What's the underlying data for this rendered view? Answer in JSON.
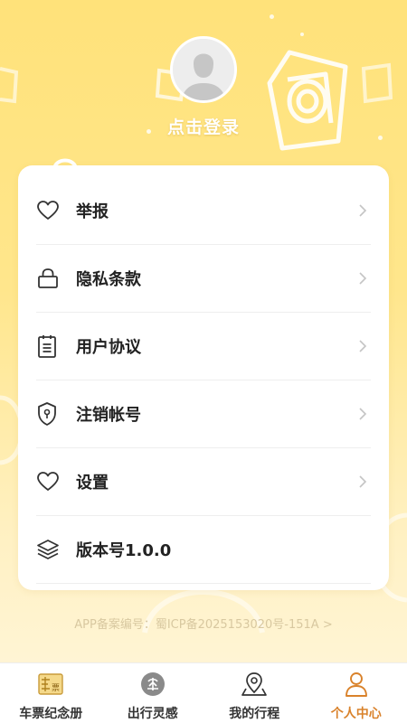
{
  "profile": {
    "login_text": "点击登录"
  },
  "menu": [
    {
      "label": "举报",
      "icon": "heart-icon"
    },
    {
      "label": "隐私条款",
      "icon": "lock-icon"
    },
    {
      "label": "用户协议",
      "icon": "document-icon"
    },
    {
      "label": "注销帐号",
      "icon": "shield-icon"
    },
    {
      "label": "设置",
      "icon": "heart-icon"
    },
    {
      "label": "版本号1.0.0",
      "icon": "layers-icon"
    }
  ],
  "footer": {
    "icp": "APP备案编号：蜀ICP备2025153020号-151A >"
  },
  "tabs": [
    {
      "label": "车票纪念册",
      "icon": "ticket-icon",
      "active": false
    },
    {
      "label": "出行灵感",
      "icon": "inspiration-icon",
      "active": false
    },
    {
      "label": "我的行程",
      "icon": "map-pin-icon",
      "active": false
    },
    {
      "label": "个人中心",
      "icon": "user-icon",
      "active": true
    }
  ],
  "colors": {
    "accent": "#d9822b",
    "background_top": "#ffe27a",
    "background_bottom": "#fff6dc"
  }
}
